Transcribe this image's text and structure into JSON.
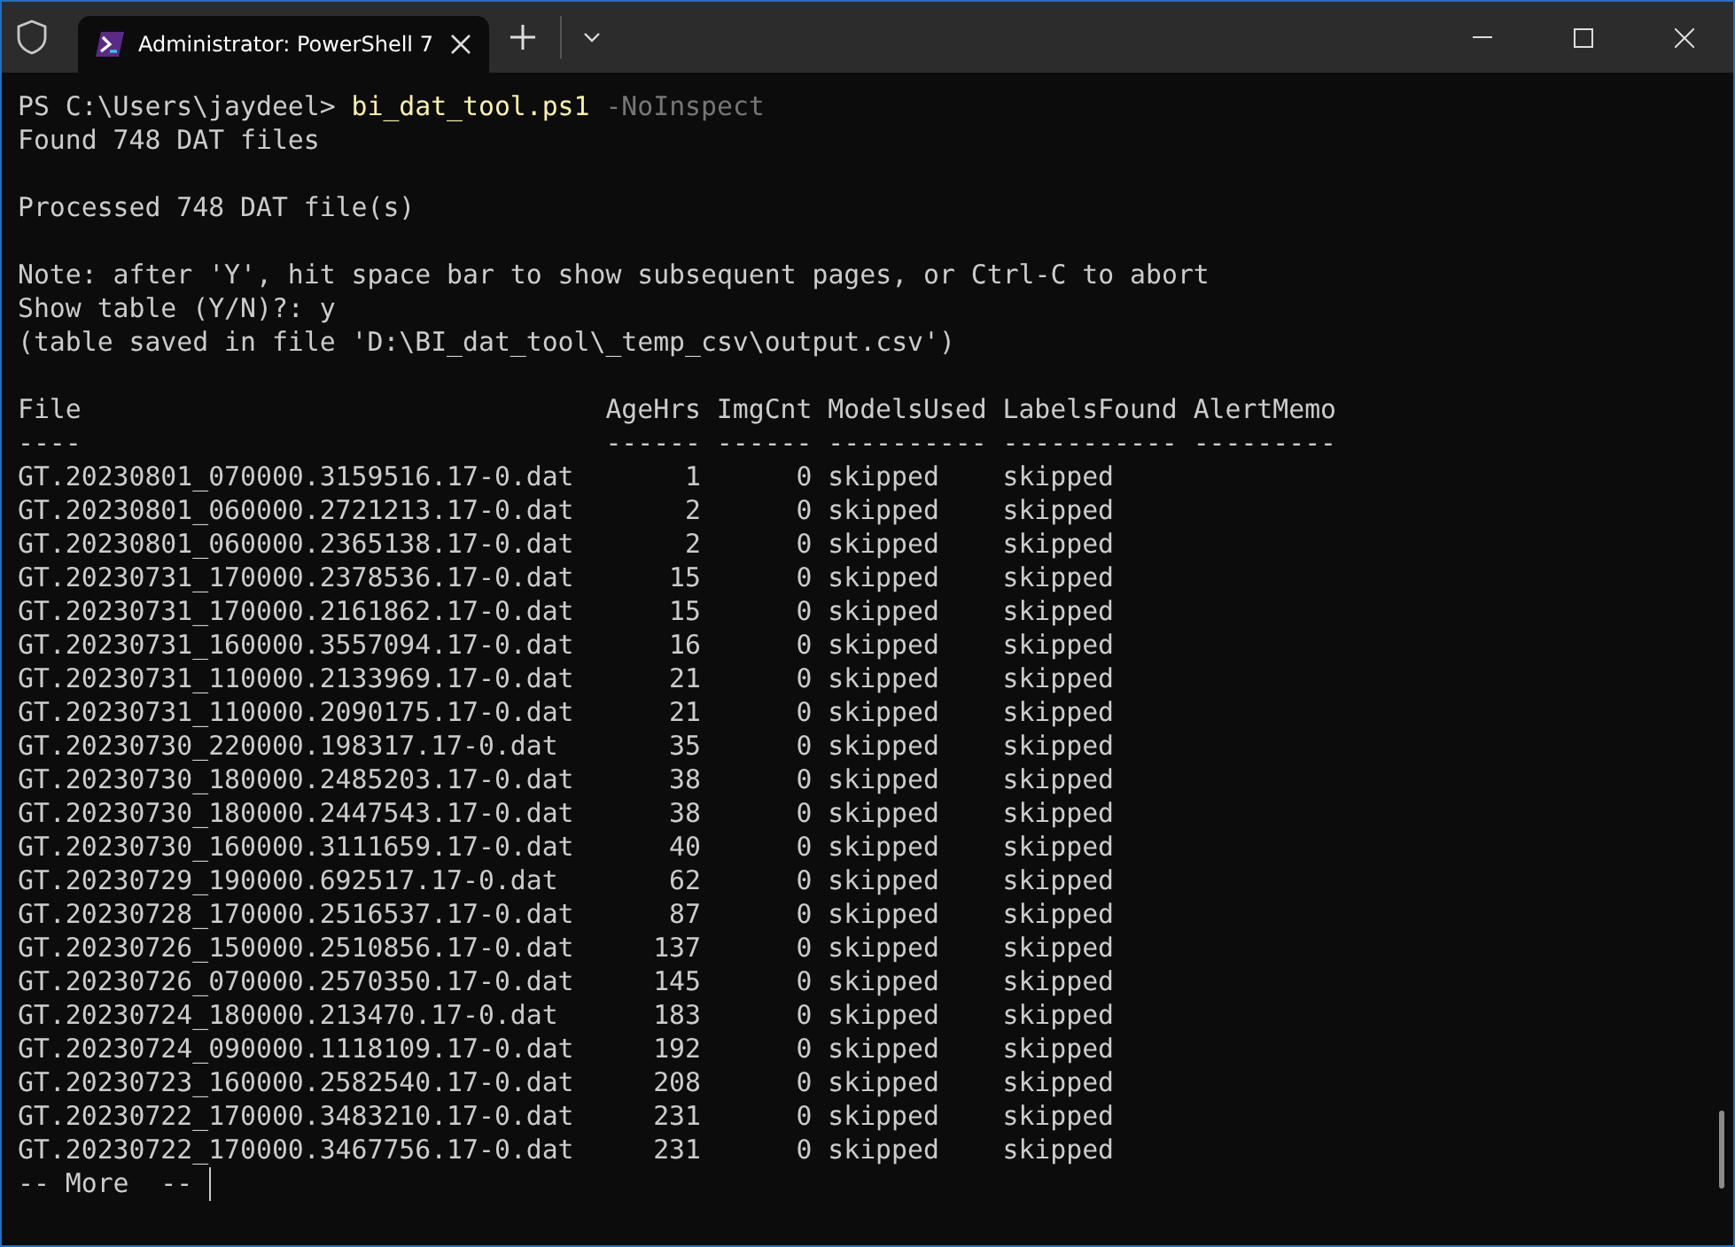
{
  "window": {
    "title": "Administrator: PowerShell 7"
  },
  "terminal": {
    "prompt": "PS C:\\Users\\jaydeel>",
    "command": "bi_dat_tool.ps1",
    "argument": "-NoInspect",
    "blocks": [
      [
        "Found 748 DAT files"
      ],
      [
        "Processed 748 DAT file(s)"
      ],
      [
        "Note: after 'Y', hit space bar to show subsequent pages, or Ctrl-C to abort",
        "Show table (Y/N)?: y",
        "(table saved in file 'D:\\BI_dat_tool\\_temp_csv\\output.csv')"
      ]
    ],
    "table": {
      "columns": [
        {
          "name": "File",
          "underline": "----",
          "kind": "text"
        },
        {
          "name": "AgeHrs",
          "underline": "------",
          "kind": "number"
        },
        {
          "name": "ImgCnt",
          "underline": "------",
          "kind": "number"
        },
        {
          "name": "ModelsUsed",
          "underline": "----------",
          "kind": "text"
        },
        {
          "name": "LabelsFound",
          "underline": "-----------",
          "kind": "text"
        },
        {
          "name": "AlertMemo",
          "underline": "---------",
          "kind": "text"
        }
      ],
      "rows": [
        [
          "GT.20230801_070000.3159516.17-0.dat",
          "1",
          "0",
          "skipped",
          "skipped"
        ],
        [
          "GT.20230801_060000.2721213.17-0.dat",
          "2",
          "0",
          "skipped",
          "skipped"
        ],
        [
          "GT.20230801_060000.2365138.17-0.dat",
          "2",
          "0",
          "skipped",
          "skipped"
        ],
        [
          "GT.20230731_170000.2378536.17-0.dat",
          "15",
          "0",
          "skipped",
          "skipped"
        ],
        [
          "GT.20230731_170000.2161862.17-0.dat",
          "15",
          "0",
          "skipped",
          "skipped"
        ],
        [
          "GT.20230731_160000.3557094.17-0.dat",
          "16",
          "0",
          "skipped",
          "skipped"
        ],
        [
          "GT.20230731_110000.2133969.17-0.dat",
          "21",
          "0",
          "skipped",
          "skipped"
        ],
        [
          "GT.20230731_110000.2090175.17-0.dat",
          "21",
          "0",
          "skipped",
          "skipped"
        ],
        [
          "GT.20230730_220000.198317.17-0.dat",
          "35",
          "0",
          "skipped",
          "skipped"
        ],
        [
          "GT.20230730_180000.2485203.17-0.dat",
          "38",
          "0",
          "skipped",
          "skipped"
        ],
        [
          "GT.20230730_180000.2447543.17-0.dat",
          "38",
          "0",
          "skipped",
          "skipped"
        ],
        [
          "GT.20230730_160000.3111659.17-0.dat",
          "40",
          "0",
          "skipped",
          "skipped"
        ],
        [
          "GT.20230729_190000.692517.17-0.dat",
          "62",
          "0",
          "skipped",
          "skipped"
        ],
        [
          "GT.20230728_170000.2516537.17-0.dat",
          "87",
          "0",
          "skipped",
          "skipped"
        ],
        [
          "GT.20230726_150000.2510856.17-0.dat",
          "137",
          "0",
          "skipped",
          "skipped"
        ],
        [
          "GT.20230726_070000.2570350.17-0.dat",
          "145",
          "0",
          "skipped",
          "skipped"
        ],
        [
          "GT.20230724_180000.213470.17-0.dat",
          "183",
          "0",
          "skipped",
          "skipped"
        ],
        [
          "GT.20230724_090000.1118109.17-0.dat",
          "192",
          "0",
          "skipped",
          "skipped"
        ],
        [
          "GT.20230723_160000.2582540.17-0.dat",
          "208",
          "0",
          "skipped",
          "skipped"
        ],
        [
          "GT.20230722_170000.3483210.17-0.dat",
          "231",
          "0",
          "skipped",
          "skipped"
        ],
        [
          "GT.20230722_170000.3467756.17-0.dat",
          "231",
          "0",
          "skipped",
          "skipped"
        ]
      ]
    },
    "pager": "-- More  --"
  }
}
